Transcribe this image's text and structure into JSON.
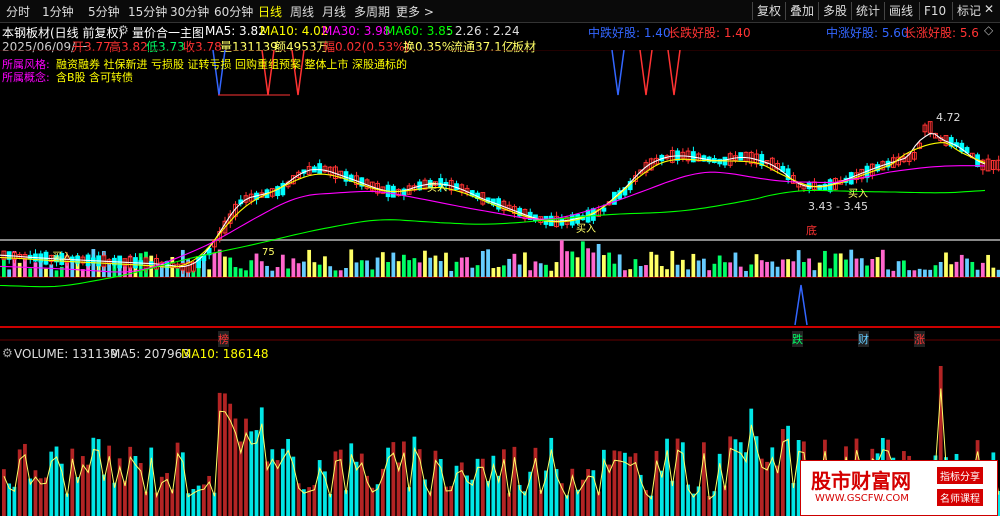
{
  "timeframe_tabs": [
    {
      "label": "分时",
      "active": false
    },
    {
      "label": "1分钟",
      "active": false
    },
    {
      "label": "5分钟",
      "active": false
    },
    {
      "label": "15分钟",
      "active": false
    },
    {
      "label": "30分钟",
      "active": false
    },
    {
      "label": "60分钟",
      "active": false
    },
    {
      "label": "日线",
      "active": true
    },
    {
      "label": "周线",
      "active": false
    },
    {
      "label": "月线",
      "active": false
    },
    {
      "label": "多周期",
      "active": false
    },
    {
      "label": "更多 >",
      "active": false
    }
  ],
  "toolbar": [
    "复权",
    "叠加",
    "多股",
    "统计",
    "画线",
    "F10",
    "标记"
  ],
  "close_icon": "close-icon",
  "header": {
    "title": "本钢板材(日线 前复权)",
    "indicator_name": "量价合一主图",
    "ma5": "MA5: 3.82",
    "ma10": "MA10: 4.02",
    "ma30": "MA30: 3.98",
    "ma60": "MA60: 3.85",
    "extra1": ": 2.26",
    "extra2": ": 2.24",
    "sig_mid_left": "中跌好股: 1.40",
    "sig_long_left": "长跌好股: 1.40",
    "sig_mid_right": "中涨好股: 5.60",
    "sig_long_right": "长涨好股: 5.6"
  },
  "quote": {
    "date": "2025/06/09/一",
    "open": "开3.77",
    "high": "高3.82",
    "low": "低3.73",
    "close": "收3.78",
    "volume": "量131139",
    "amount": "额4953万",
    "amplitude": "幅0.02(0.53%)",
    "turnover": "换0.35%",
    "float": "流通37.1亿",
    "sector": "板材"
  },
  "concepts": {
    "label1": "所属风格:",
    "text1": "融资融券 社保新进 亏损股 证转亏损 回购重组预案 整体上市 深股通标的",
    "label2": "所属概念:",
    "text2": "含B股 含可转债"
  },
  "chart_annotations": {
    "price_high": "4.72",
    "price_low": "3.43 - 3.45",
    "buy_label": "买入",
    "bottom_label": "底",
    "level_label": "75"
  },
  "event_markers": [
    "榜",
    "跌",
    "财",
    "涨"
  ],
  "volume_panel": {
    "volume": "VOLUME: 131139",
    "ma5": "MA5: 207963",
    "ma10": "MA10: 186148"
  },
  "watermark": {
    "title": "股市财富网",
    "url": "WWW.GSCFW.COM",
    "tag1": "指标分享",
    "tag2": "名师课程"
  },
  "colors": {
    "up": "#ff3333",
    "down": "#00ffff",
    "ma5": "#ffffff",
    "ma10": "#ffff00",
    "ma30": "#ff00ff",
    "ma60": "#00ff00",
    "active_tab": "#ffff00"
  }
}
